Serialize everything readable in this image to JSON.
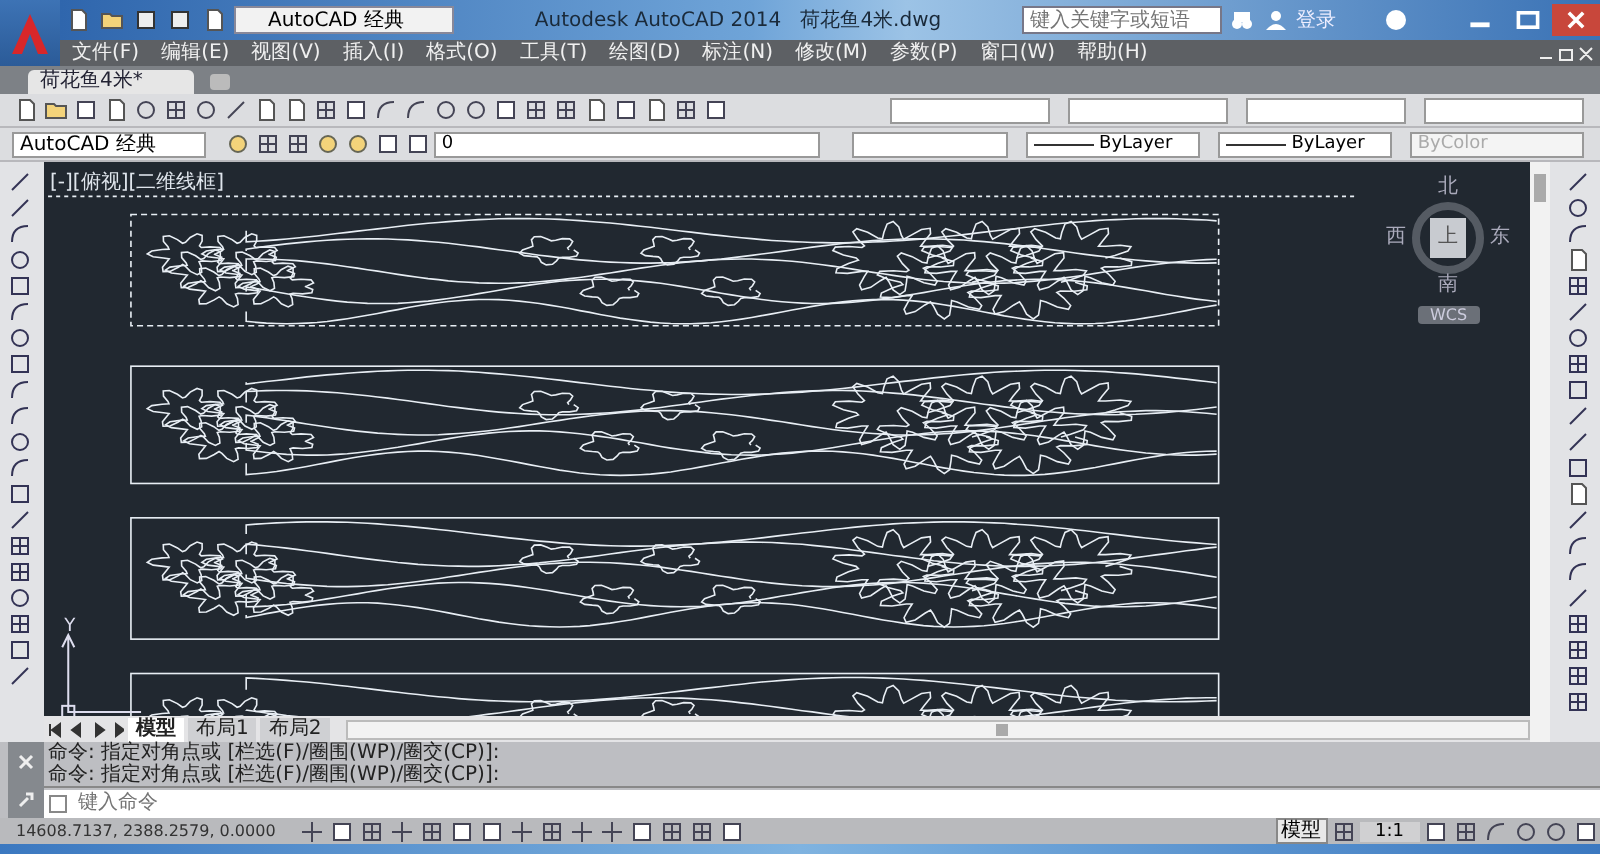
{
  "title_bar": {
    "workspace": "AutoCAD 经典",
    "app_title": "Autodesk AutoCAD 2014",
    "file_name": "荷花鱼4米.dwg",
    "search_placeholder": "键入关键字或短语",
    "sign_in": "登录"
  },
  "menu": [
    "文件(F)",
    "编辑(E)",
    "视图(V)",
    "插入(I)",
    "格式(O)",
    "工具(T)",
    "绘图(D)",
    "标注(N)",
    "修改(M)",
    "参数(P)",
    "窗口(W)",
    "帮助(H)"
  ],
  "file_tabs": [
    {
      "label": "荷花鱼4米*",
      "selected": true
    }
  ],
  "toolbar": {
    "workspace": "AutoCAD 经典",
    "layer": "0",
    "linetype": "ByLayer",
    "lineweight": "ByLayer",
    "plot_style": "ByColor",
    "plot_style_disabled": true
  },
  "viewport": {
    "label": "[-][俯视][二维线框]",
    "viewcube": {
      "north": "北",
      "west": "西",
      "east": "东",
      "south": "南",
      "face": "上",
      "wcs": "WCS"
    },
    "ucs_y": "Y"
  },
  "layout_tabs": [
    {
      "label": "模型",
      "selected": true
    },
    {
      "label": "布局1",
      "selected": false
    },
    {
      "label": "布局2",
      "selected": false
    }
  ],
  "command_history": [
    "命令: 指定对角点或 [栏选(F)/圈围(WP)/圈交(CP)]:",
    "命令: 指定对角点或 [栏选(F)/圈围(WP)/圈交(CP)]:"
  ],
  "command_input": {
    "placeholder": "键入命令"
  },
  "status_bar": {
    "coordinates": "14608.7137, 2388.2579, 0.0000",
    "model": "模型",
    "scale": "1:1"
  }
}
